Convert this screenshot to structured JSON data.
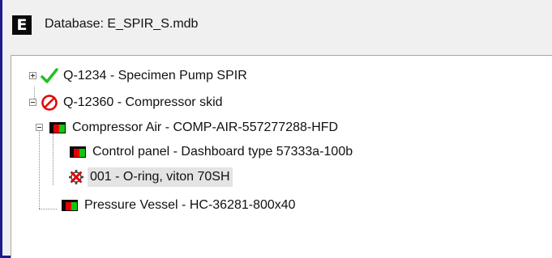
{
  "window": {
    "icon_letter": "E",
    "title": "Database: E_SPIR_S.mdb"
  },
  "tree": {
    "items": [
      {
        "label": "Q-1234 - Specimen Pump SPIR",
        "icon": "green-check-icon",
        "expander": "plus"
      },
      {
        "label": "Q-12360 - Compressor skid",
        "icon": "red-prohibited-icon",
        "expander": "minus"
      },
      {
        "label": "Compressor Air - COMP-AIR-557277288-HFD",
        "icon": "equipment-flag-icon",
        "expander": "minus"
      },
      {
        "label": "Control panel - Dashboard type 57333a-100b",
        "icon": "equipment-flag-icon"
      },
      {
        "label": "001 - O-ring, viton 70SH",
        "icon": "spare-part-gear-x-icon",
        "selected": true
      },
      {
        "label": "Pressure Vessel - HC-36281-800x40",
        "icon": "equipment-flag-icon"
      }
    ]
  },
  "colors": {
    "window_border": "#1c1c8c",
    "check_green": "#22c022",
    "prohibited_red": "#e60000"
  }
}
